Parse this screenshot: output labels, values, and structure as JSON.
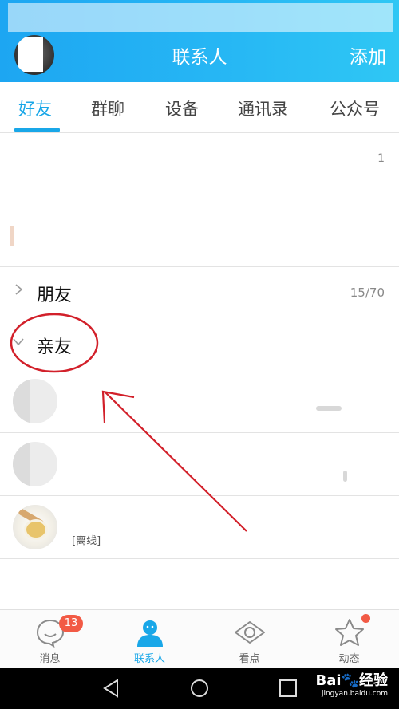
{
  "header": {
    "title": "联系人",
    "add_label": "添加"
  },
  "tabs": [
    {
      "label": "好友",
      "active": true
    },
    {
      "label": "群聊",
      "active": false
    },
    {
      "label": "设备",
      "active": false
    },
    {
      "label": "通讯录",
      "active": false
    },
    {
      "label": "公众号",
      "active": false
    }
  ],
  "top_rows": {
    "first_count": "1"
  },
  "groups": [
    {
      "name": "朋友",
      "count": "15/70",
      "expanded": false
    },
    {
      "name": "亲友",
      "count": "",
      "expanded": true
    }
  ],
  "friends": [
    {
      "status": ""
    },
    {
      "status": ""
    },
    {
      "status": "[离线]"
    }
  ],
  "bottom_nav": [
    {
      "label": "消息",
      "badge": "13",
      "icon": "chat-bubble-smile-icon"
    },
    {
      "label": "联系人",
      "icon": "contacts-person-icon",
      "active": true
    },
    {
      "label": "看点",
      "icon": "eye-icon"
    },
    {
      "label": "动态",
      "icon": "star-icon",
      "dot": true
    }
  ],
  "watermark": {
    "brand": "Bai🐾经验",
    "url": "jingyan.baidu.com"
  },
  "colors": {
    "accent": "#19a7e8",
    "header": "#27b8f4",
    "badge": "#f25a45",
    "annotation": "#d2202a"
  }
}
